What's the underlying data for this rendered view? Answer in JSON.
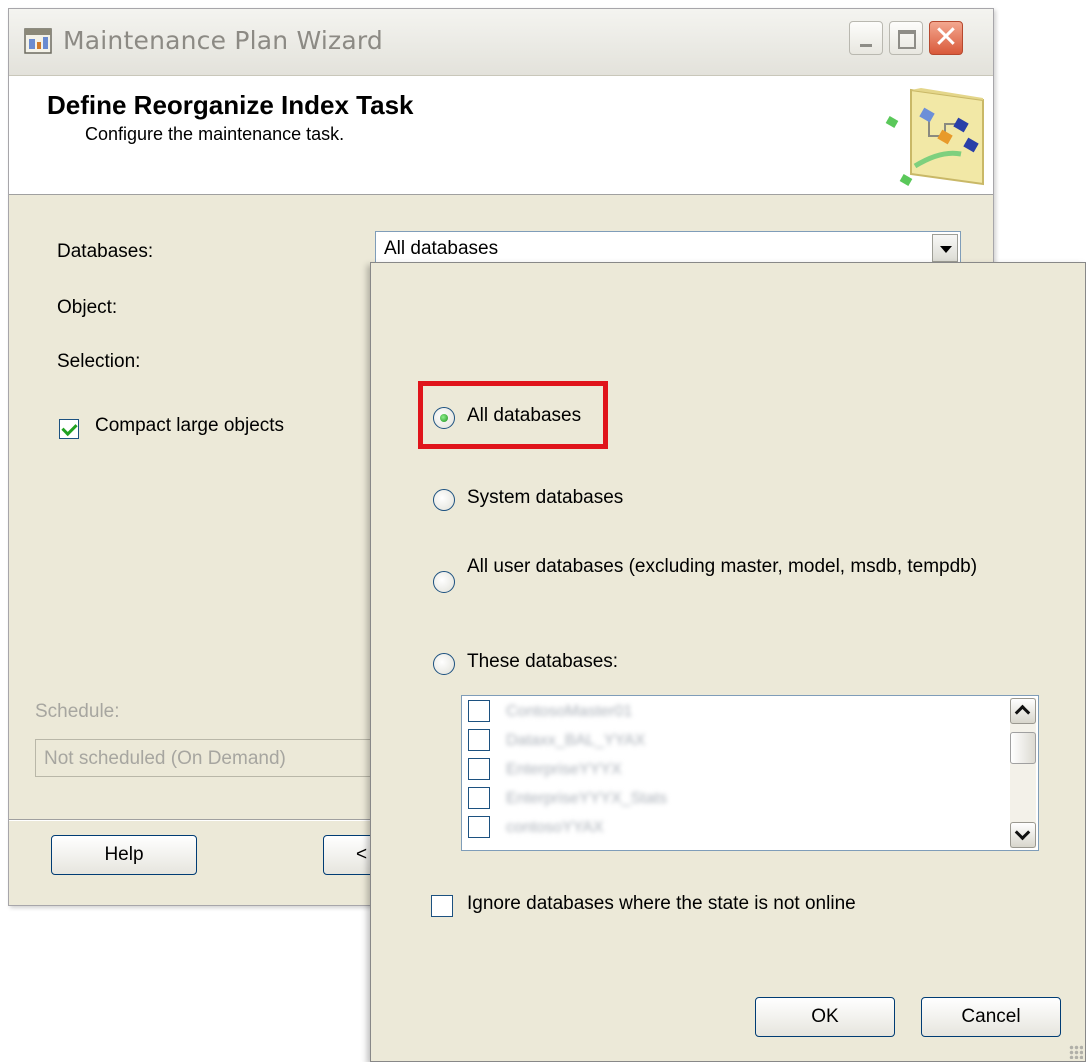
{
  "wizard": {
    "title": "Maintenance Plan Wizard",
    "icon": "wizard-app-icon",
    "header_title": "Define Reorganize Index Task",
    "header_subtitle": "Configure the maintenance task.",
    "databases_label": "Databases:",
    "databases_value": "All databases",
    "object_label": "Object:",
    "selection_label": "Selection:",
    "compact_label": "Compact large objects",
    "compact_checked": true,
    "schedule_label": "Schedule:",
    "schedule_value": "Not scheduled (On Demand)",
    "help_button": "Help",
    "back_button_partial": "<"
  },
  "popup": {
    "options": [
      {
        "label": "All databases",
        "selected": true
      },
      {
        "label": "System databases",
        "selected": false
      },
      {
        "label": "All user databases  (excluding master, model, msdb, tempdb)",
        "selected": false
      },
      {
        "label": "These databases:",
        "selected": false
      }
    ],
    "database_rows_blurred": [
      "ContosoMaster01",
      "Dataxx_BAL_YYAX",
      "EnterpriseYYYX",
      "EnterpriseYYYX_Stats",
      "contosoYYAX"
    ],
    "ignore_offline_label": "Ignore databases where the state is not online",
    "ignore_offline_checked": false,
    "ok_button": "OK",
    "cancel_button": "Cancel"
  },
  "colors": {
    "highlight": "#e0141b",
    "dialog_bg": "#ece9d8",
    "button_border": "#003c74"
  }
}
